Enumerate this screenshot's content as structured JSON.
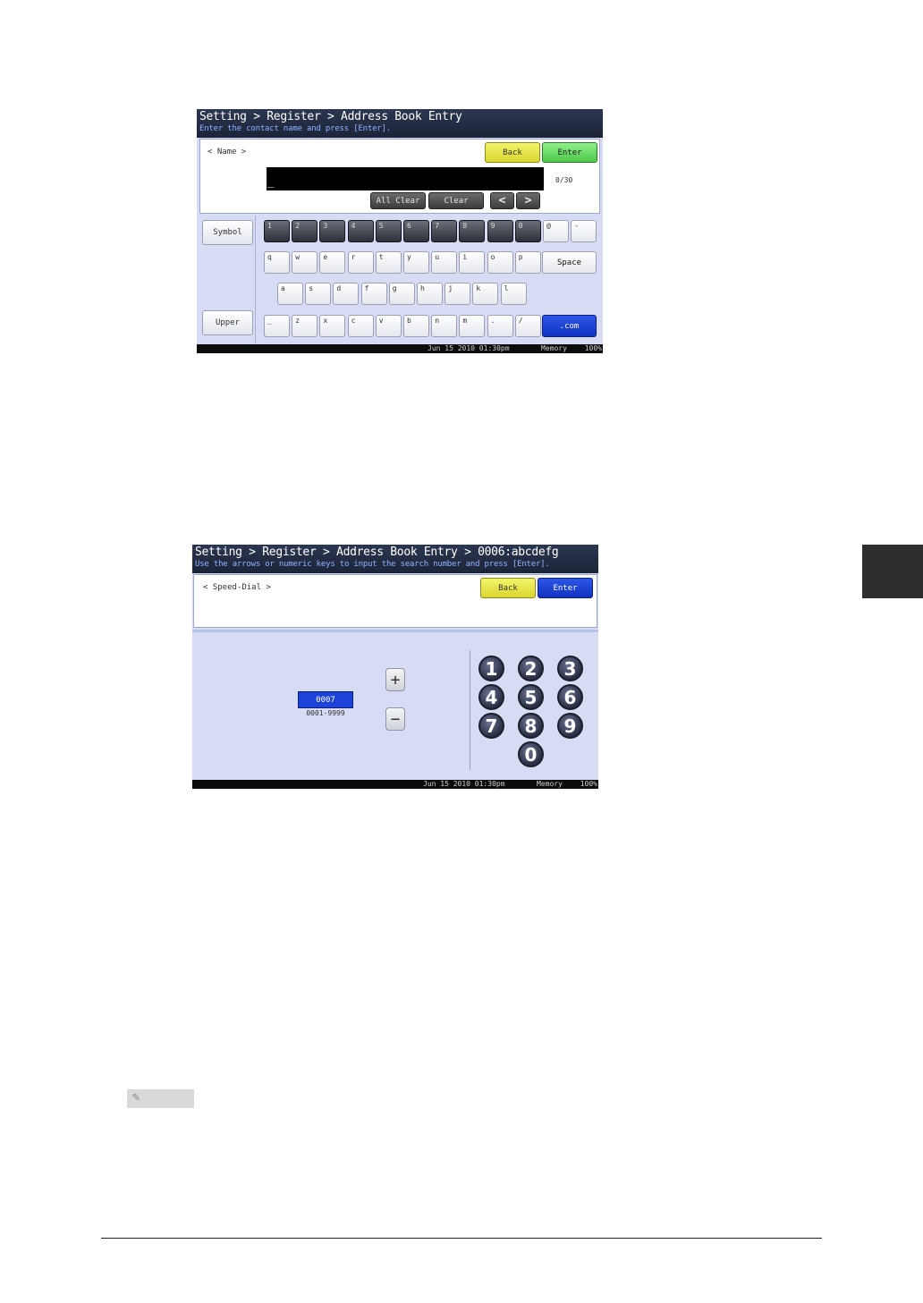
{
  "screen1": {
    "header": {
      "title": "Setting > Register > Address Book Entry",
      "subtitle": "Enter the contact name and press [Enter]."
    },
    "field_label": "< Name >",
    "back_label": "Back",
    "enter_label": "Enter",
    "input_value": "_",
    "counter": "0/30",
    "all_clear_label": "All Clear",
    "clear_label": "Clear",
    "left_arrow": "<",
    "right_arrow": ">",
    "symbol_label": "Symbol",
    "upper_label": "Upper",
    "space_label": "Space",
    "com_label": ".com",
    "row_numbers": [
      "1",
      "2",
      "3",
      "4",
      "5",
      "6",
      "7",
      "8",
      "9",
      "0"
    ],
    "row_numbers_extra": [
      "@",
      "-"
    ],
    "row_q": [
      "q",
      "w",
      "e",
      "r",
      "t",
      "y",
      "u",
      "i",
      "o",
      "p"
    ],
    "row_a": [
      "a",
      "s",
      "d",
      "f",
      "g",
      "h",
      "j",
      "k",
      "l"
    ],
    "row_z": [
      "_",
      "z",
      "x",
      "c",
      "v",
      "b",
      "n",
      "m",
      ".",
      "/"
    ],
    "status": {
      "datetime": "Jun 15 2010 01:30pm",
      "memory": "Memory",
      "percent": "100%"
    }
  },
  "screen2": {
    "header": {
      "title": "Setting > Register > Address Book Entry > 0006:abcdefg",
      "subtitle": "Use the arrows or numeric keys to input the search number and press [Enter]."
    },
    "field_label": "< Speed-Dial >",
    "back_label": "Back",
    "enter_label": "Enter",
    "number_value": "0007",
    "number_range": "0001-9999",
    "plus_label": "+",
    "minus_label": "−",
    "keypad": [
      "1",
      "2",
      "3",
      "4",
      "5",
      "6",
      "7",
      "8",
      "9",
      "0"
    ],
    "status": {
      "datetime": "Jun 15 2010 01:30pm",
      "memory": "Memory",
      "percent": "100%"
    }
  },
  "colors": {
    "back": "#e8e64a",
    "enter_green": "#6ede6a",
    "enter_blue": "#1c42d8",
    "screen_bg": "#d7dcf4",
    "header_bg": "#222b40"
  },
  "icons": {
    "note": "pencil-note-icon"
  }
}
